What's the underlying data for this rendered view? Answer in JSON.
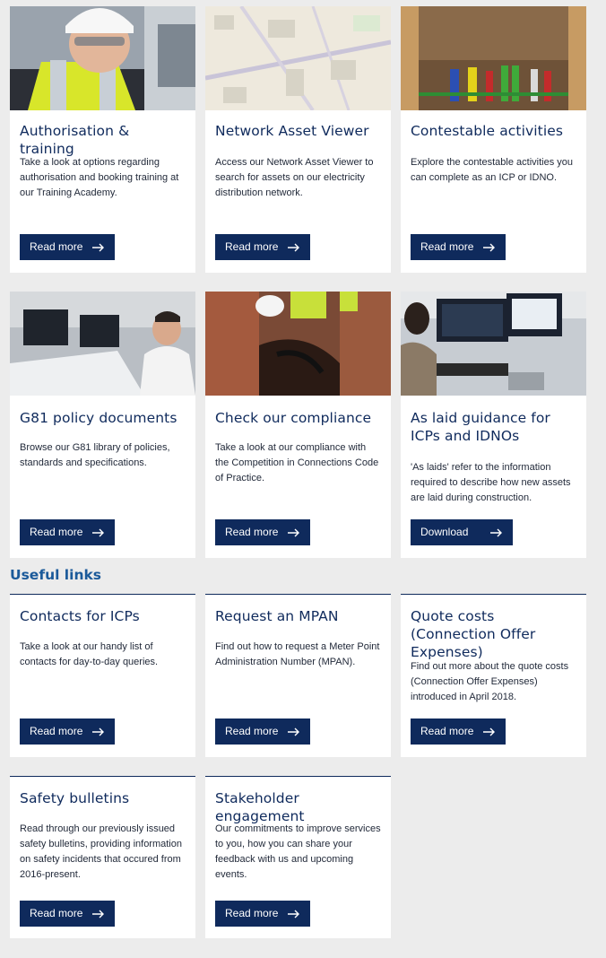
{
  "feature_cards": [
    {
      "title": "Authorisation & training",
      "description": "Take a look at options regarding authorisation and booking training at our Training Academy.",
      "button": "Read more",
      "image_icon": "worker-photo"
    },
    {
      "title": "Network Asset Viewer",
      "description": "Access our Network Asset Viewer to search for assets on our electricity distribution network.",
      "button": "Read more",
      "image_icon": "map-photo"
    },
    {
      "title": "Contestable activities",
      "description": "Explore the contestable activities you can complete as an ICP or IDNO.",
      "button": "Read more",
      "image_icon": "cables-photo"
    },
    {
      "title": "G81 policy documents",
      "description": "Browse our G81 library of policies, standards and specifications.",
      "button": "Read more",
      "image_icon": "office-photo"
    },
    {
      "title": "Check our compliance",
      "description": "Take a look at our compliance with the Competition in Connections Code of Practice.",
      "button": "Read more",
      "image_icon": "excavation-photo"
    },
    {
      "title": "As laid guidance for ICPs and IDNOs",
      "description": "'As laids' refer to the information required to describe how new assets are laid during construction.",
      "button": "Download",
      "image_icon": "control-room-photo"
    }
  ],
  "useful_links": {
    "heading": "Useful links",
    "cards": [
      {
        "title": "Contacts for ICPs",
        "description": "Take a look at our handy list of contacts for day-to-day queries.",
        "button": "Read more"
      },
      {
        "title": "Request an MPAN",
        "description": "Find out how to request a Meter Point Administration Number (MPAN).",
        "button": "Read more"
      },
      {
        "title": "Quote costs (Connection Offer Expenses)",
        "description": "Find out more about the quote costs (Connection Offer Expenses) introduced in April 2018.",
        "button": "Read more"
      },
      {
        "title": "Safety bulletins",
        "description": "Read through our previously issued safety bulletins, providing information on safety incidents that occured from 2016-present.",
        "button": "Read more"
      },
      {
        "title": "Stakeholder engagement",
        "description": "Our commitments to improve services to you, how you can share your feedback with us and upcoming events.",
        "button": "Read more"
      }
    ]
  },
  "colors": {
    "page_background": "#ececec",
    "card_background": "#ffffff",
    "button": "#0f2a5c",
    "title": "#0f2a5c",
    "section_heading": "#1b5a9a"
  }
}
